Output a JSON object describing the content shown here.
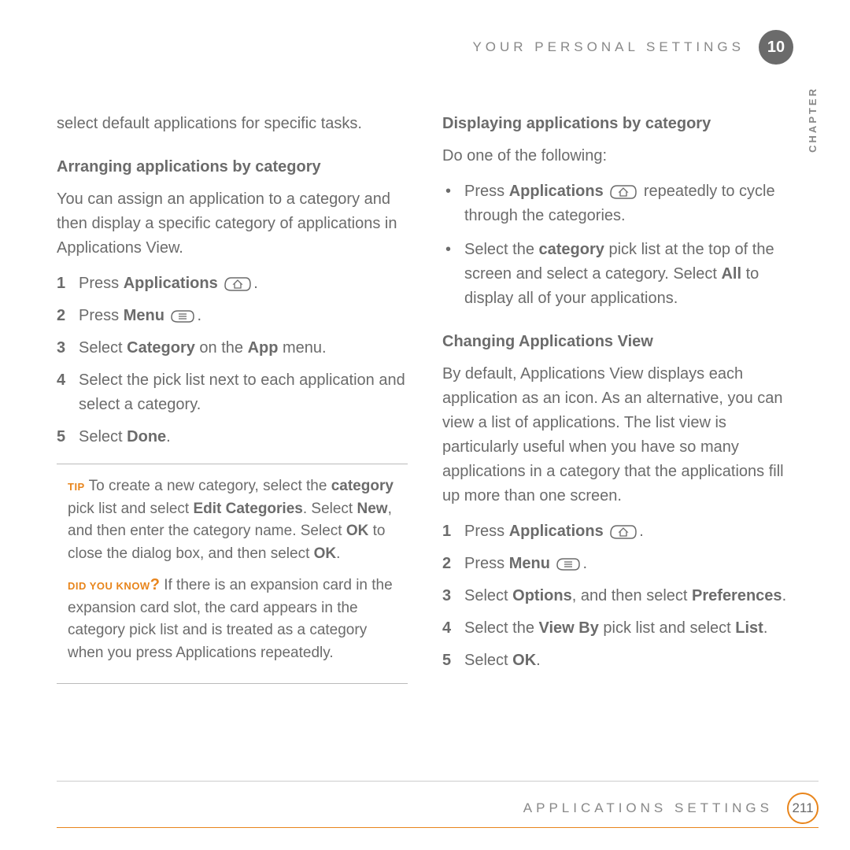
{
  "header": {
    "section": "YOUR PERSONAL SETTINGS",
    "chapter_number": "10",
    "side_label": "CHAPTER"
  },
  "left_column": {
    "intro": "select default applications for specific tasks.",
    "heading1": "Arranging applications by category",
    "para1": "You can assign an application to a category and then display a specific category of applications in Applications View.",
    "steps1": [
      {
        "num": "1",
        "pre": "Press ",
        "bold": "Applications",
        "post": " ",
        "icon": "home"
      },
      {
        "num": "2",
        "pre": "Press ",
        "bold": "Menu",
        "post": " ",
        "icon": "menu"
      },
      {
        "num": "3",
        "pre": "Select ",
        "bold": "Category",
        "mid": " on the ",
        "bold2": "App",
        "post2": " menu."
      },
      {
        "num": "4",
        "pre": "Select the pick list next to each application and select a category."
      },
      {
        "num": "5",
        "pre": "Select ",
        "bold": "Done",
        "post": "."
      }
    ],
    "tip": {
      "label": "TIP",
      "text_pre": "  To create a new category, select the ",
      "bold1": "category",
      "text_mid1": " pick list and select ",
      "bold2": "Edit Categories",
      "text_mid2": ". Select ",
      "bold3": "New",
      "text_mid3": ", and then enter the category name. Select ",
      "bold4": "OK",
      "text_mid4": " to close the dialog box, and then select ",
      "bold5": "OK",
      "text_end": "."
    },
    "dyk": {
      "label": "DID YOU KNOW",
      "q": "?",
      "text": "  If there is an expansion card in the expansion card slot, the card appears in the category pick list and is treated as a category when you press Applications repeatedly."
    }
  },
  "right_column": {
    "heading1": "Displaying applications by category",
    "para1": "Do one of the following:",
    "bullets1": [
      {
        "pre": "Press ",
        "bold": "Applications",
        "post_icon": "home",
        "post": " repeatedly to cycle through the categories."
      },
      {
        "pre": "Select the ",
        "bold": "category",
        "mid": " pick list at the top of the screen and select a category. Select ",
        "bold2": "All",
        "post2": " to display all of your applications."
      }
    ],
    "heading2": "Changing Applications View",
    "para2": "By default, Applications View displays each application as an icon. As an alternative, you can view a list of applications. The list view is particularly useful when you have so many applications in a category that the applications fill up more than one screen.",
    "steps2": [
      {
        "num": "1",
        "pre": "Press ",
        "bold": "Applications",
        "post": " ",
        "icon": "home"
      },
      {
        "num": "2",
        "pre": "Press ",
        "bold": "Menu",
        "post": " ",
        "icon": "menu"
      },
      {
        "num": "3",
        "pre": "Select ",
        "bold": "Options",
        "mid": ", and then select ",
        "bold2": "Preferences",
        "post2": "."
      },
      {
        "num": "4",
        "pre": "Select the ",
        "bold": "View By",
        "mid": " pick list and select ",
        "bold2": "List",
        "post2": "."
      },
      {
        "num": "5",
        "pre": "Select ",
        "bold": "OK",
        "post": "."
      }
    ]
  },
  "footer": {
    "section": "APPLICATIONS SETTINGS",
    "page": "211"
  }
}
